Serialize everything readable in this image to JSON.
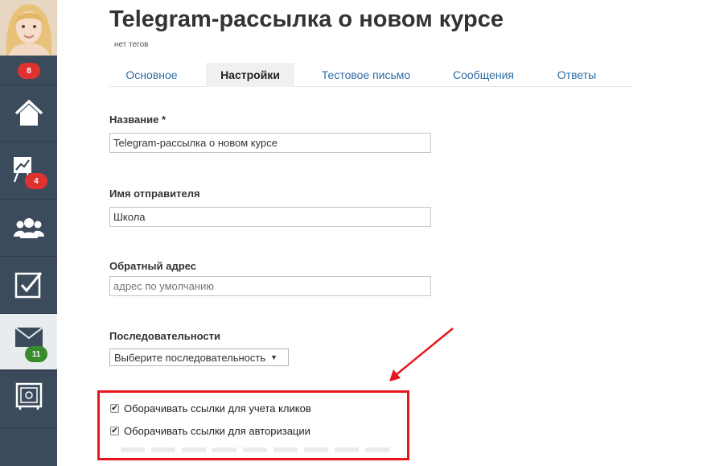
{
  "sidebar": {
    "avatar_badge": "8",
    "items": [
      {
        "name": "home",
        "icon": "home-icon",
        "badge": ""
      },
      {
        "name": "stats",
        "icon": "chart-icon",
        "badge": "4"
      },
      {
        "name": "contacts",
        "icon": "users-icon",
        "badge": ""
      },
      {
        "name": "tasks",
        "icon": "checkbox-icon",
        "badge": ""
      },
      {
        "name": "mail",
        "icon": "envelope-icon",
        "badge": "11"
      },
      {
        "name": "safe",
        "icon": "safe-icon",
        "badge": ""
      }
    ]
  },
  "page": {
    "title": "Telegram-рассылка о новом курсе",
    "tags": "нет тегов"
  },
  "tabs": [
    {
      "label": "Основное",
      "active": false
    },
    {
      "label": "Настройки",
      "active": true
    },
    {
      "label": "Тестовое письмо",
      "active": false
    },
    {
      "label": "Сообщения",
      "active": false
    },
    {
      "label": "Ответы",
      "active": false
    }
  ],
  "form": {
    "name_label": "Название *",
    "name_value": "Telegram-рассылка о новом курсе",
    "sender_label": "Имя отправителя",
    "sender_value": "Школа",
    "reply_label": "Обратный адрес",
    "reply_placeholder": "адрес по умолчанию",
    "sequences_label": "Последовательности",
    "sequences_selected": "Выберите последовательность",
    "checkbox_track_clicks": "Оборачивать ссылки для учета кликов",
    "checkbox_auth": "Оборачивать ссылки для авторизации"
  },
  "colors": {
    "sidebar": "#3b4b5b",
    "link": "#2e6da4",
    "highlight": "#e8151b",
    "badge_red": "#e03131",
    "badge_green": "#3a8a2e"
  }
}
